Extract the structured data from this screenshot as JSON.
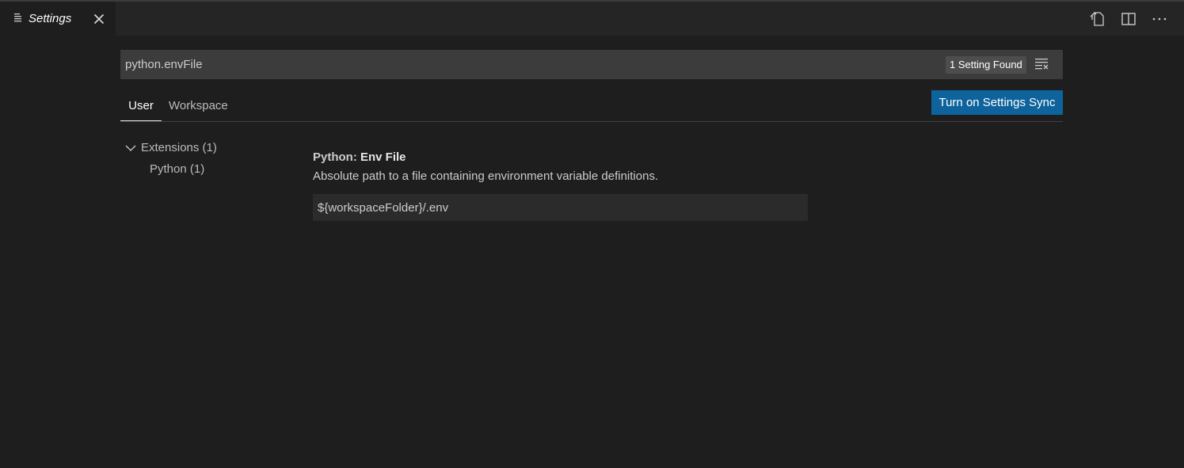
{
  "editor_tab": {
    "label": "Settings",
    "icon": "settings-list-icon",
    "close_icon": "close-icon"
  },
  "actions": [
    {
      "name": "open-settings-json-icon"
    },
    {
      "name": "split-editor-icon"
    },
    {
      "name": "more-actions-icon"
    }
  ],
  "search": {
    "value": "python.envFile",
    "count_label": "1 Setting Found",
    "clear_icon": "clear-filter-icon"
  },
  "scopes": {
    "user": "User",
    "workspace": "Workspace",
    "active": "User"
  },
  "sync_button": "Turn on Settings Sync",
  "toc": {
    "group": "Extensions (1)",
    "child": "Python (1)"
  },
  "setting": {
    "category": "Python: ",
    "name": "Env File",
    "description": "Absolute path to a file containing environment variable definitions.",
    "value": "${workspaceFolder}/.env"
  },
  "colors": {
    "accent": "#0e639c",
    "background": "#1e1e1e",
    "input_background": "#3c3c3c"
  }
}
